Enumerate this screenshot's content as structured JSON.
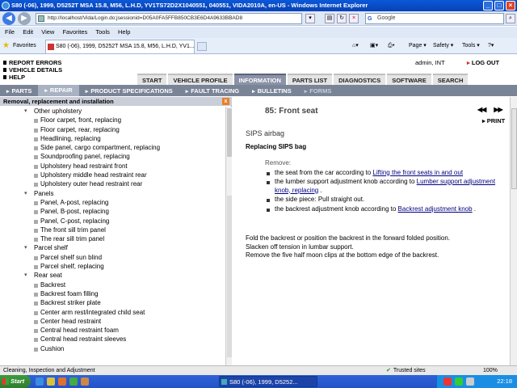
{
  "window": {
    "title": "S80 (-06), 1999, D5252T MSA 15.8, M56, L.H.D, YV1TS72D2X1040551, 040551, VIDA2010A, en-US - Windows Internet Explorer"
  },
  "address": {
    "url": "http://localhost/Vida/Login.do;jsessionid=D05A0FA5FFB850CB3E6D4A9633BBAD8",
    "search_placeholder": "Google"
  },
  "menu": [
    "File",
    "Edit",
    "View",
    "Favorites",
    "Tools",
    "Help"
  ],
  "favbar": {
    "favorites_label": "Favorites",
    "tab_label": "S80 (-06), 1999, D5252T MSA 15.8, M56, L.H.D, YV1...",
    "page_menu": "Page",
    "safety_menu": "Safety",
    "tools_menu": "Tools"
  },
  "app": {
    "top_links": [
      "REPORT ERRORS",
      "VEHICLE DETAILS",
      "HELP"
    ],
    "user": "admin, INT",
    "logout": "LOG OUT",
    "main_tabs": [
      "START",
      "VEHICLE PROFILE",
      "INFORMATION",
      "PARTS LIST",
      "DIAGNOSTICS",
      "SOFTWARE",
      "SEARCH"
    ],
    "active_main_tab": "INFORMATION",
    "sub_nav": [
      "PARTS",
      "REPAIR",
      "PRODUCT SPECIFICATIONS",
      "FAULT TRACING",
      "BULLETINS",
      "FORMS"
    ],
    "active_sub_nav": "REPAIR",
    "left_panel": {
      "title": "Removal, replacement and installation",
      "close": "x",
      "tree": [
        {
          "type": "group",
          "label": "Other upholstery"
        },
        {
          "type": "item",
          "label": "Floor carpet, front, replacing"
        },
        {
          "type": "item",
          "label": "Floor carpet, rear, replacing"
        },
        {
          "type": "item",
          "label": "Headlining, replacing"
        },
        {
          "type": "item",
          "label": "Side panel, cargo compartment, replacing"
        },
        {
          "type": "item",
          "label": "Soundproofing panel, replacing"
        },
        {
          "type": "item",
          "label": "Upholstery head restraint front"
        },
        {
          "type": "item",
          "label": "Upholstery middle head restraint rear"
        },
        {
          "type": "item",
          "label": "Upholstery outer head restraint rear"
        },
        {
          "type": "group",
          "label": "Panels"
        },
        {
          "type": "item",
          "label": "Panel, A-post, replacing"
        },
        {
          "type": "item",
          "label": "Panel, B-post, replacing"
        },
        {
          "type": "item",
          "label": "Panel, C-post, replacing"
        },
        {
          "type": "item",
          "label": "The front sill trim panel"
        },
        {
          "type": "item",
          "label": "The rear sill trim panel"
        },
        {
          "type": "group",
          "label": "Parcel shelf"
        },
        {
          "type": "item",
          "label": "Parcel shelf sun blind"
        },
        {
          "type": "item",
          "label": "Parcel shelf, replacing"
        },
        {
          "type": "group",
          "label": "Rear seat"
        },
        {
          "type": "item",
          "label": "Backrest"
        },
        {
          "type": "item",
          "label": "Backrest foam filling"
        },
        {
          "type": "item",
          "label": "Backrest striker plate"
        },
        {
          "type": "item",
          "label": "Center arm rest/integrated child seat"
        },
        {
          "type": "item",
          "label": "Center head restraint"
        },
        {
          "type": "item",
          "label": "Central head restraint foam"
        },
        {
          "type": "item",
          "label": "Central head restraint sleeves"
        },
        {
          "type": "item",
          "label": "Cushion"
        }
      ]
    },
    "right_panel": {
      "section_title": "85: Front seat",
      "print": "PRINT",
      "heading": "SIPS airbag",
      "subheading": "Replacing SIPS bag",
      "remove_label": "Remove:",
      "steps": [
        {
          "text": "the seat from the car according to ",
          "link": "Lifting the front seats in and out",
          "after": ""
        },
        {
          "text": "the lumber support adjustment knob according to ",
          "link": "Lumber support adjustment knob, replacing",
          "after": " ."
        },
        {
          "text": "the side piece: Pull straight out.",
          "link": "",
          "after": ""
        },
        {
          "text": "the backrest adjustment knob according to ",
          "link": "Backrest adjustment knob",
          "after": " ."
        }
      ],
      "instructions": [
        "Fold the backrest or position the backrest in the forward folded position.",
        "Slacken off tension in lumbar support.",
        "Remove the five half moon clips at the bottom edge of the backrest."
      ]
    }
  },
  "statusbar": {
    "text": "Cleaning, Inspection and Adjustment",
    "zone": "Trusted sites",
    "zoom": "100%"
  },
  "taskbar": {
    "start": "Start",
    "task": "S80 (-06), 1999, D5252...",
    "clock": "22:18"
  }
}
